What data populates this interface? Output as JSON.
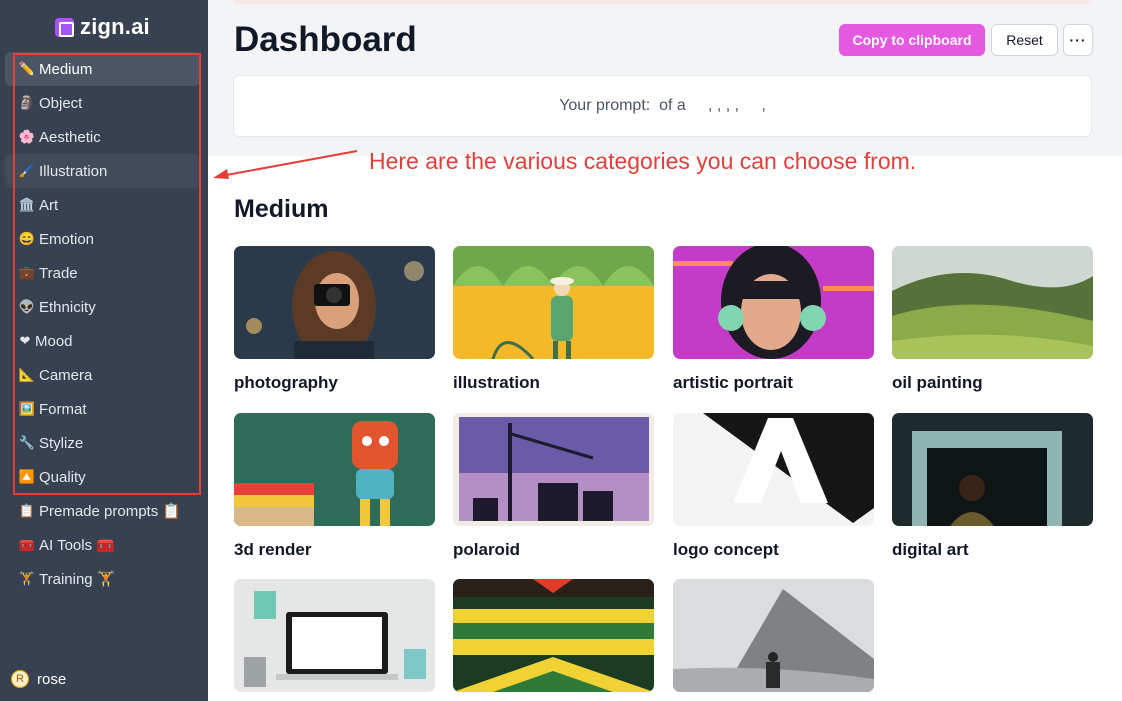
{
  "app": {
    "logo_text": "zign.ai"
  },
  "sidebar": {
    "items": [
      {
        "label": "Medium",
        "icon": "✏️"
      },
      {
        "label": "Object",
        "icon": "🗿"
      },
      {
        "label": "Aesthetic",
        "icon": "🌸"
      },
      {
        "label": "Illustration",
        "icon": "🖌️"
      },
      {
        "label": "Art",
        "icon": "🏛️"
      },
      {
        "label": "Emotion",
        "icon": "😄"
      },
      {
        "label": "Trade",
        "icon": "💼"
      },
      {
        "label": "Ethnicity",
        "icon": "👽"
      },
      {
        "label": "Mood",
        "icon": "❤"
      },
      {
        "label": "Camera",
        "icon": "📐"
      },
      {
        "label": "Format",
        "icon": "🖼️"
      },
      {
        "label": "Stylize",
        "icon": "🔧"
      },
      {
        "label": "Quality",
        "icon": "🔼"
      },
      {
        "label": "Premade prompts 📋",
        "icon": "📋"
      },
      {
        "label": "AI Tools 🧰",
        "icon": "🧰"
      },
      {
        "label": "Training 🏋",
        "icon": "🏋"
      }
    ],
    "user": {
      "avatar": "R",
      "name": "rose"
    }
  },
  "header": {
    "title": "Dashboard",
    "copy_label": "Copy to clipboard",
    "reset_label": "Reset",
    "more_label": "···"
  },
  "prompt": {
    "text": "Your prompt:  of a     , , , ,     ,"
  },
  "annotation": "Here are the various categories you can choose from.",
  "section": {
    "title": "Medium",
    "cards": [
      {
        "label": "photography"
      },
      {
        "label": "illustration"
      },
      {
        "label": "artistic portrait"
      },
      {
        "label": "oil painting"
      },
      {
        "label": "3d render"
      },
      {
        "label": "polaroid"
      },
      {
        "label": "logo concept"
      },
      {
        "label": "digital art"
      },
      {
        "label": ""
      },
      {
        "label": ""
      },
      {
        "label": ""
      }
    ]
  },
  "colors": {
    "sidebar": "#374151",
    "accent": "#e559e0",
    "annotation": "#e53e3a",
    "logo": "#a855f7"
  }
}
